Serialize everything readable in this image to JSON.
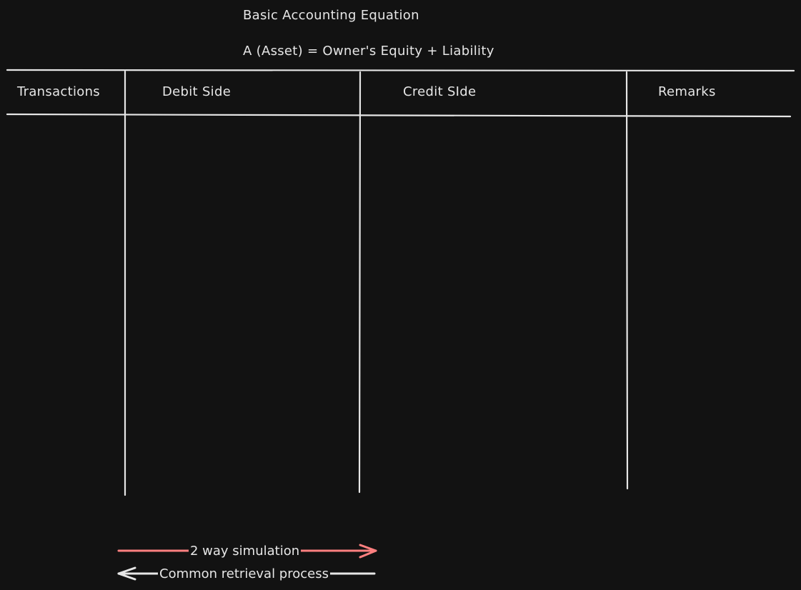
{
  "header": {
    "title": "Basic Accounting Equation",
    "equation": "A (Asset) = Owner's Equity + Liability"
  },
  "table": {
    "columns": [
      "Transactions",
      "Debit Side",
      "Credit SIde",
      "Remarks"
    ]
  },
  "legend": {
    "items": [
      {
        "label": "2 way simulation",
        "color": "#ff8080",
        "direction": "right"
      },
      {
        "label": "Common retrieval process",
        "color": "#e6e6e6",
        "direction": "left"
      }
    ]
  },
  "colors": {
    "background": "#121212",
    "stroke": "#e6e6e6",
    "accent": "#ff8080"
  }
}
